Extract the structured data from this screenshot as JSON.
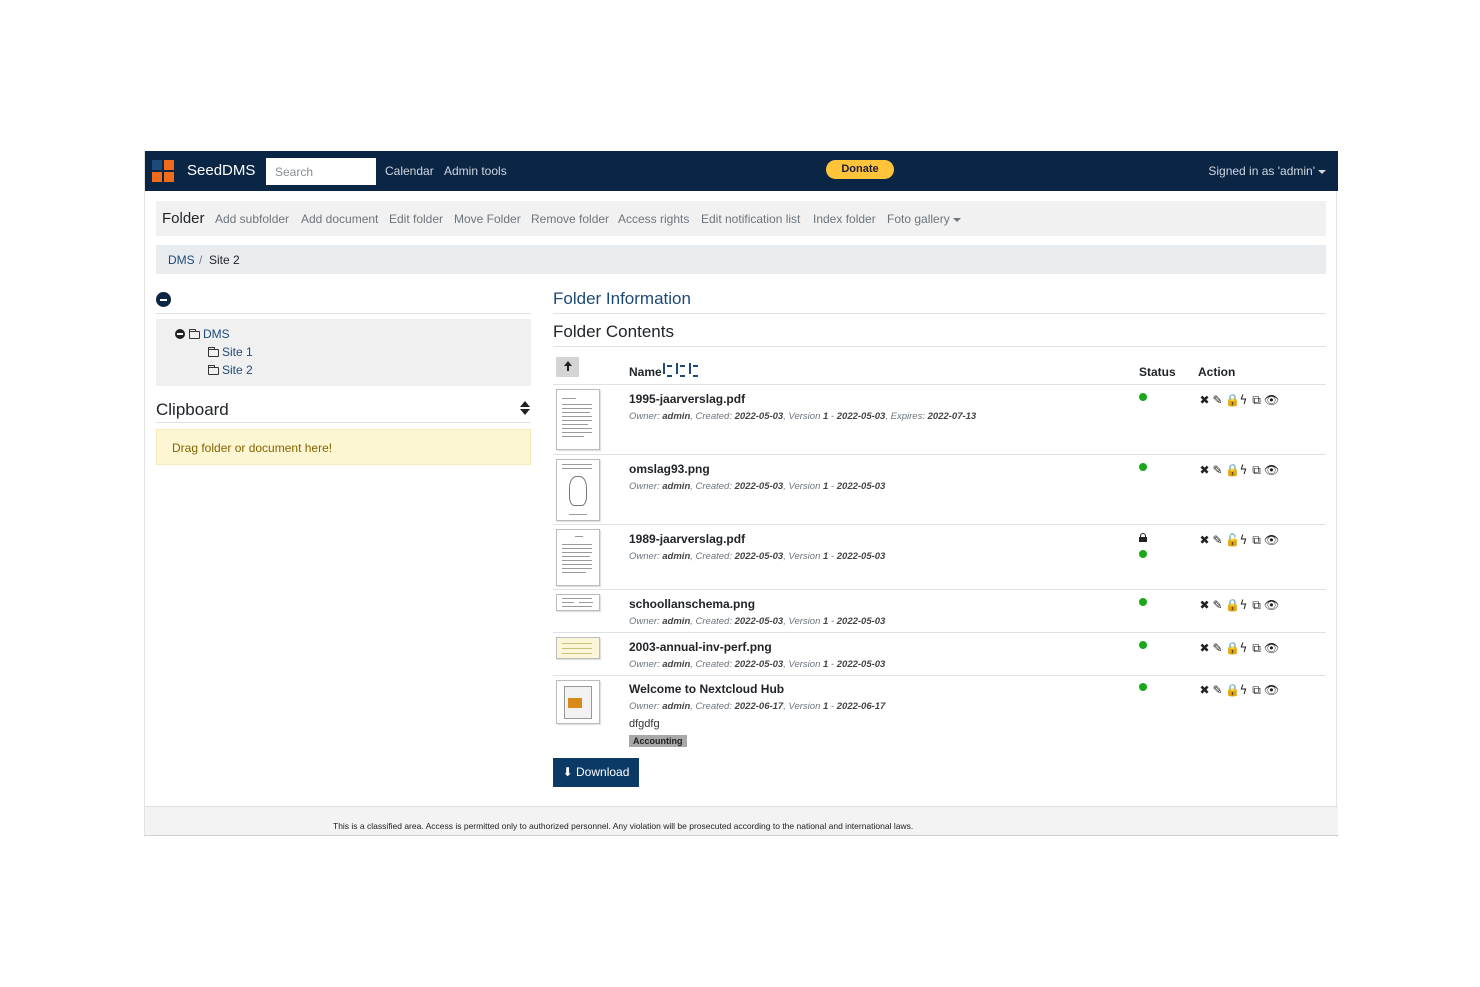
{
  "navbar": {
    "brand": "SeedDMS",
    "search_placeholder": "Search",
    "links": [
      "Calendar",
      "Admin tools"
    ],
    "donate": "Donate",
    "signed_in": "Signed in as 'admin'",
    "colors": {
      "bg": "#0b2545",
      "donate": "#ffc439"
    }
  },
  "actionbar": {
    "title": "Folder",
    "items": [
      "Add subfolder",
      "Add document",
      "Edit folder",
      "Move Folder",
      "Remove folder",
      "Access rights",
      "Edit notification list",
      "Index folder",
      "Foto gallery"
    ]
  },
  "breadcrumb": {
    "root": "DMS",
    "sep": "/",
    "current": "Site 2"
  },
  "tree": {
    "root": "DMS",
    "children": [
      "Site 1",
      "Site 2"
    ]
  },
  "clipboard": {
    "title": "Clipboard",
    "dropzone": "Drag folder or document here!"
  },
  "main": {
    "folder_info": "Folder Information",
    "folder_contents": "Folder Contents",
    "columns": {
      "name": "Name",
      "status": "Status",
      "action": "Action"
    },
    "meta_labels": {
      "owner": "Owner:",
      "created": "Created:",
      "version": "Version",
      "expires": "Expires:"
    },
    "documents": [
      {
        "name": "1995-jaarverslag.pdf",
        "owner": "admin",
        "created": "2022-05-03",
        "version": "1",
        "version_date": "2022-05-03",
        "expires": "2022-07-13",
        "locked": false,
        "status_color": "#1aa81a"
      },
      {
        "name": "omslag93.png",
        "owner": "admin",
        "created": "2022-05-03",
        "version": "1",
        "version_date": "2022-05-03",
        "locked": false,
        "status_color": "#1aa81a"
      },
      {
        "name": "1989-jaarverslag.pdf",
        "owner": "admin",
        "created": "2022-05-03",
        "version": "1",
        "version_date": "2022-05-03",
        "locked": true,
        "status_color": "#1aa81a"
      },
      {
        "name": "schoollanschema.png",
        "owner": "admin",
        "created": "2022-05-03",
        "version": "1",
        "version_date": "2022-05-03",
        "locked": false,
        "status_color": "#1aa81a"
      },
      {
        "name": "2003-annual-inv-perf.png",
        "owner": "admin",
        "created": "2022-05-03",
        "version": "1",
        "version_date": "2022-05-03",
        "locked": false,
        "status_color": "#1aa81a"
      },
      {
        "name": "Welcome to Nextcloud Hub",
        "owner": "admin",
        "created": "2022-06-17",
        "version": "1",
        "version_date": "2022-06-17",
        "comment": "dfgdfg",
        "category": "Accounting",
        "locked": false,
        "status_color": "#1aa81a"
      }
    ],
    "action_icons": [
      "delete-icon",
      "edit-icon",
      "lock-icon",
      "bolt-icon",
      "copy-icon",
      "eye-icon"
    ],
    "download": "Download"
  },
  "footer": "This is a classified area. Access is permitted only to authorized personnel. Any violation will be prosecuted according to the national and international laws."
}
